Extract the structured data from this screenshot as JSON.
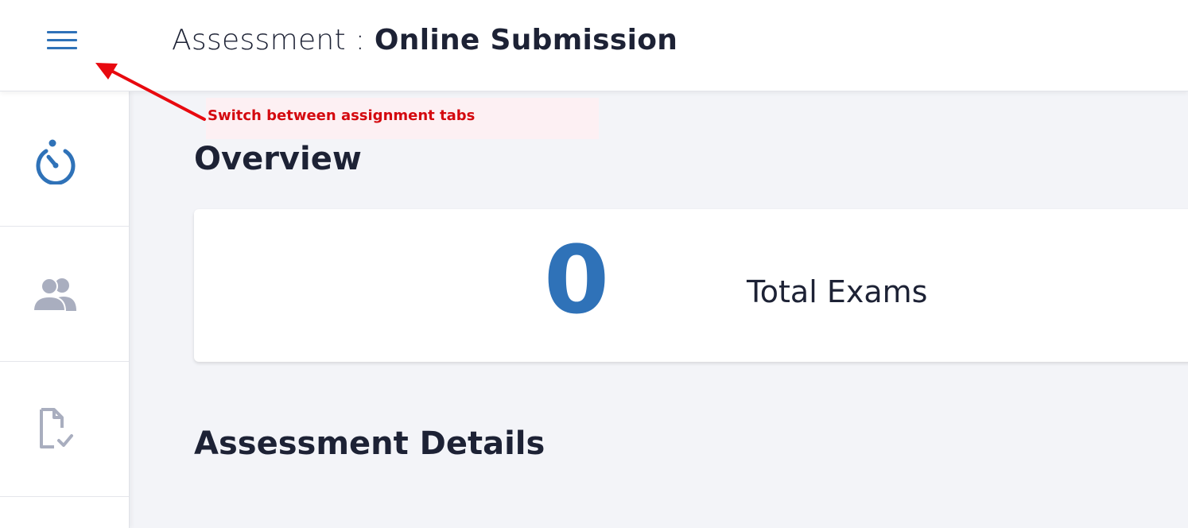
{
  "header": {
    "title_prefix": "Assessment : ",
    "title_name": "Online Submission",
    "menu_icon": "hamburger-menu-icon"
  },
  "sidebar": {
    "items": [
      {
        "icon": "stopwatch-icon",
        "active": true
      },
      {
        "icon": "people-icon",
        "active": false
      },
      {
        "icon": "file-check-icon",
        "active": false
      }
    ]
  },
  "annotation": {
    "text": "Switch between assignment tabs",
    "color": "#d4090f"
  },
  "overview": {
    "heading": "Overview",
    "total_exams_value": "0",
    "total_exams_label": "Total Exams"
  },
  "details": {
    "heading": "Assessment Details"
  },
  "colors": {
    "accent": "#2f72b8",
    "text_dark": "#1d2235",
    "icon_inactive": "#a9aebf",
    "background": "#f3f4f8"
  }
}
